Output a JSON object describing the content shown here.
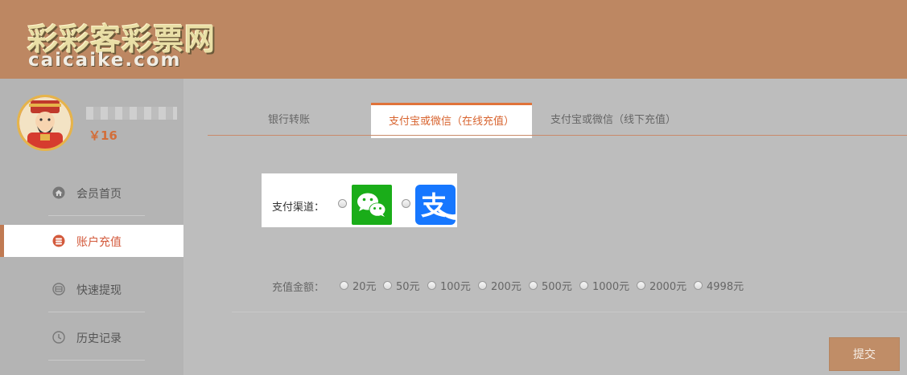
{
  "site": {
    "logo_cn": "彩彩客彩票网",
    "logo_en": "caicaike.com",
    "header_color": "#bd8762"
  },
  "user": {
    "balance": "￥16"
  },
  "sidebar": {
    "items": [
      {
        "label": "会员首页",
        "icon": "home-icon"
      },
      {
        "label": "账户充值",
        "icon": "coins-icon",
        "active": true
      },
      {
        "label": "快速提现",
        "icon": "wallet-icon"
      },
      {
        "label": "历史记录",
        "icon": "clock-icon"
      }
    ]
  },
  "tabs": [
    {
      "label": "银行转账"
    },
    {
      "label": "支付宝或微信（在线充值）",
      "active": true
    },
    {
      "label": "支付宝或微信（线下充值）"
    }
  ],
  "payment": {
    "channel_label": "支付渠道：",
    "channels": [
      {
        "name": "wechat-pay-icon"
      },
      {
        "name": "alipay-icon",
        "glyph": "支"
      }
    ]
  },
  "amount": {
    "label": "充值金额：",
    "options": [
      "20元",
      "50元",
      "100元",
      "200元",
      "500元",
      "1000元",
      "2000元",
      "4998元"
    ]
  },
  "submit": {
    "label": "提交"
  },
  "colors": {
    "accent": "#e0733a",
    "overlay": "#bdbdbd",
    "wechat": "#1aad19",
    "alipay": "#1677ff"
  }
}
